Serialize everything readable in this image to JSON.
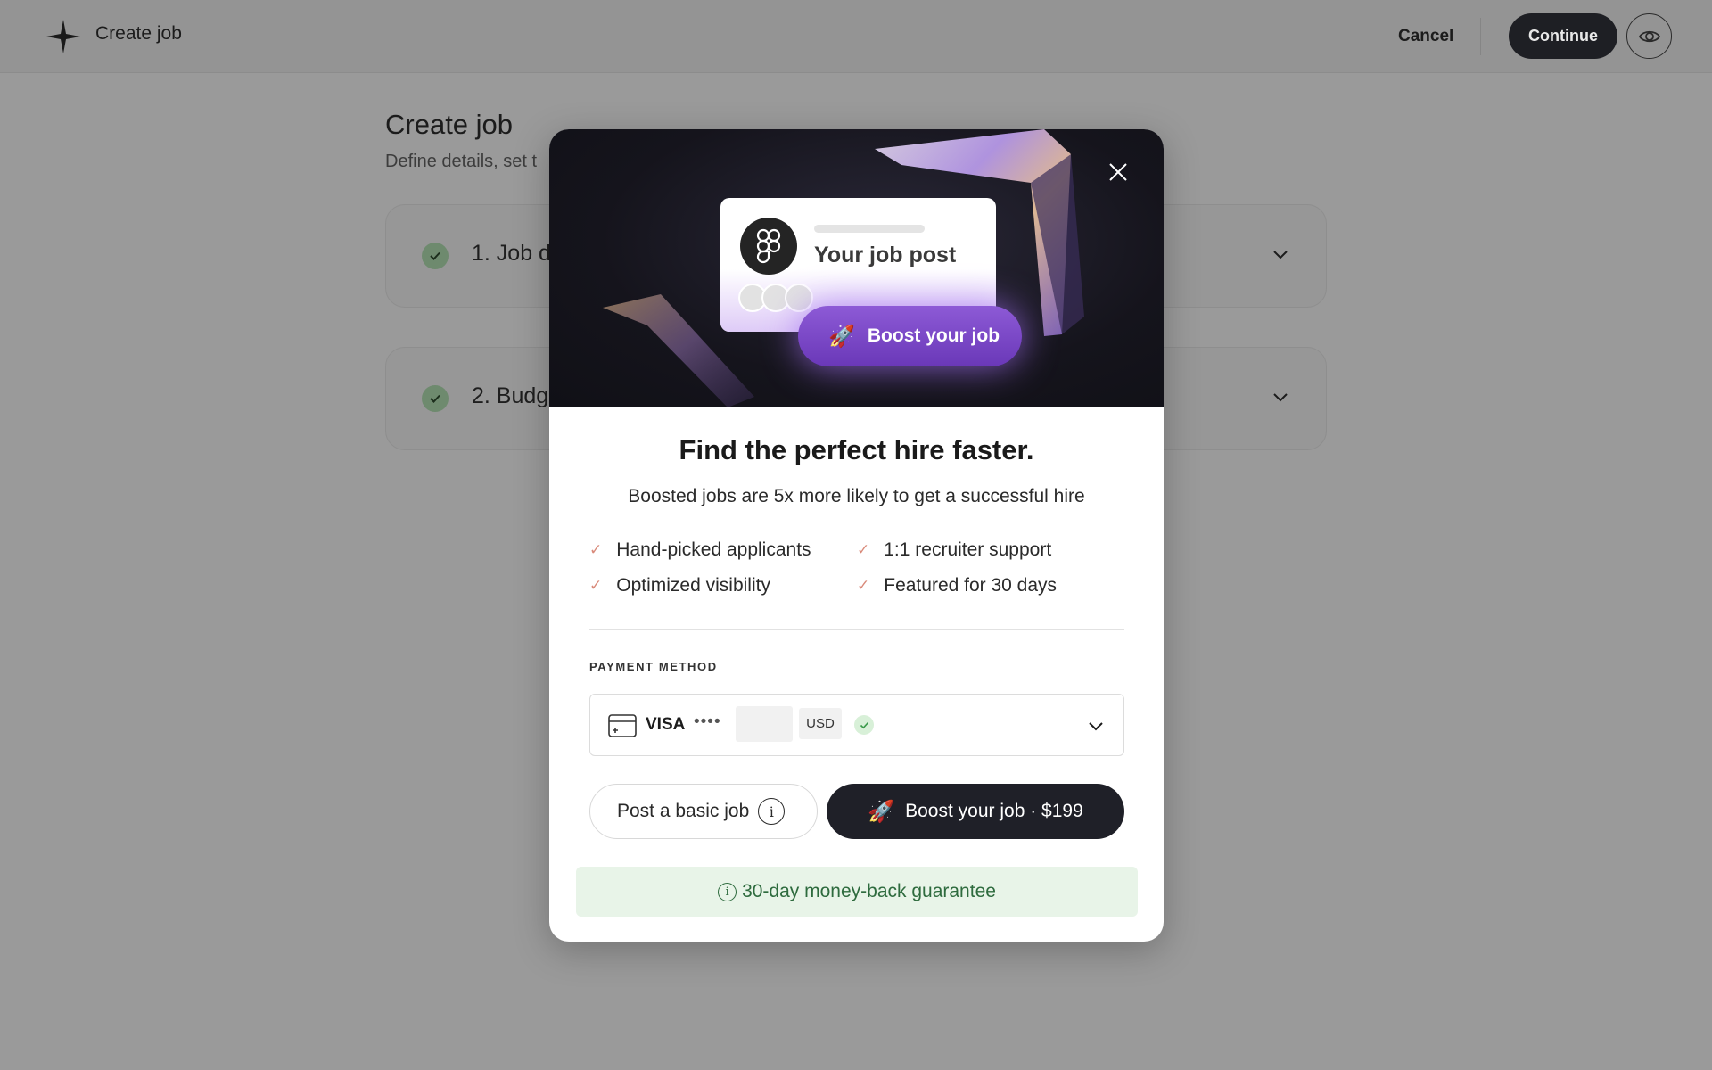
{
  "header": {
    "title": "Create job",
    "cancel_label": "Cancel",
    "continue_label": "Continue"
  },
  "page": {
    "heading": "Create job",
    "subheading": "Define details, set t",
    "steps": [
      {
        "label": "1. Job d"
      },
      {
        "label": "2. Budg"
      }
    ]
  },
  "modal": {
    "hero": {
      "card_title": "Your job post",
      "boost_pill": "Boost your job"
    },
    "title": "Find the perfect hire faster.",
    "subtitle": "Boosted jobs are 5x more likely to get a successful hire",
    "features": [
      "Hand-picked applicants",
      "1:1 recruiter support",
      "Optimized visibility",
      "Featured for 30 days"
    ],
    "payment": {
      "label": "PAYMENT METHOD",
      "brand": "VISA",
      "masked": "••••",
      "currency": "USD"
    },
    "basic_button": "Post a basic job",
    "boost_button": "Boost your job · $199",
    "guarantee": "30-day money-back guarantee"
  },
  "colors": {
    "accent_dark": "#1f2028",
    "boost_purple": "#7a46c6",
    "check_green": "#6e8a6e",
    "guarantee_bg": "#e8f4e8",
    "guarantee_text": "#2e6b3e"
  }
}
